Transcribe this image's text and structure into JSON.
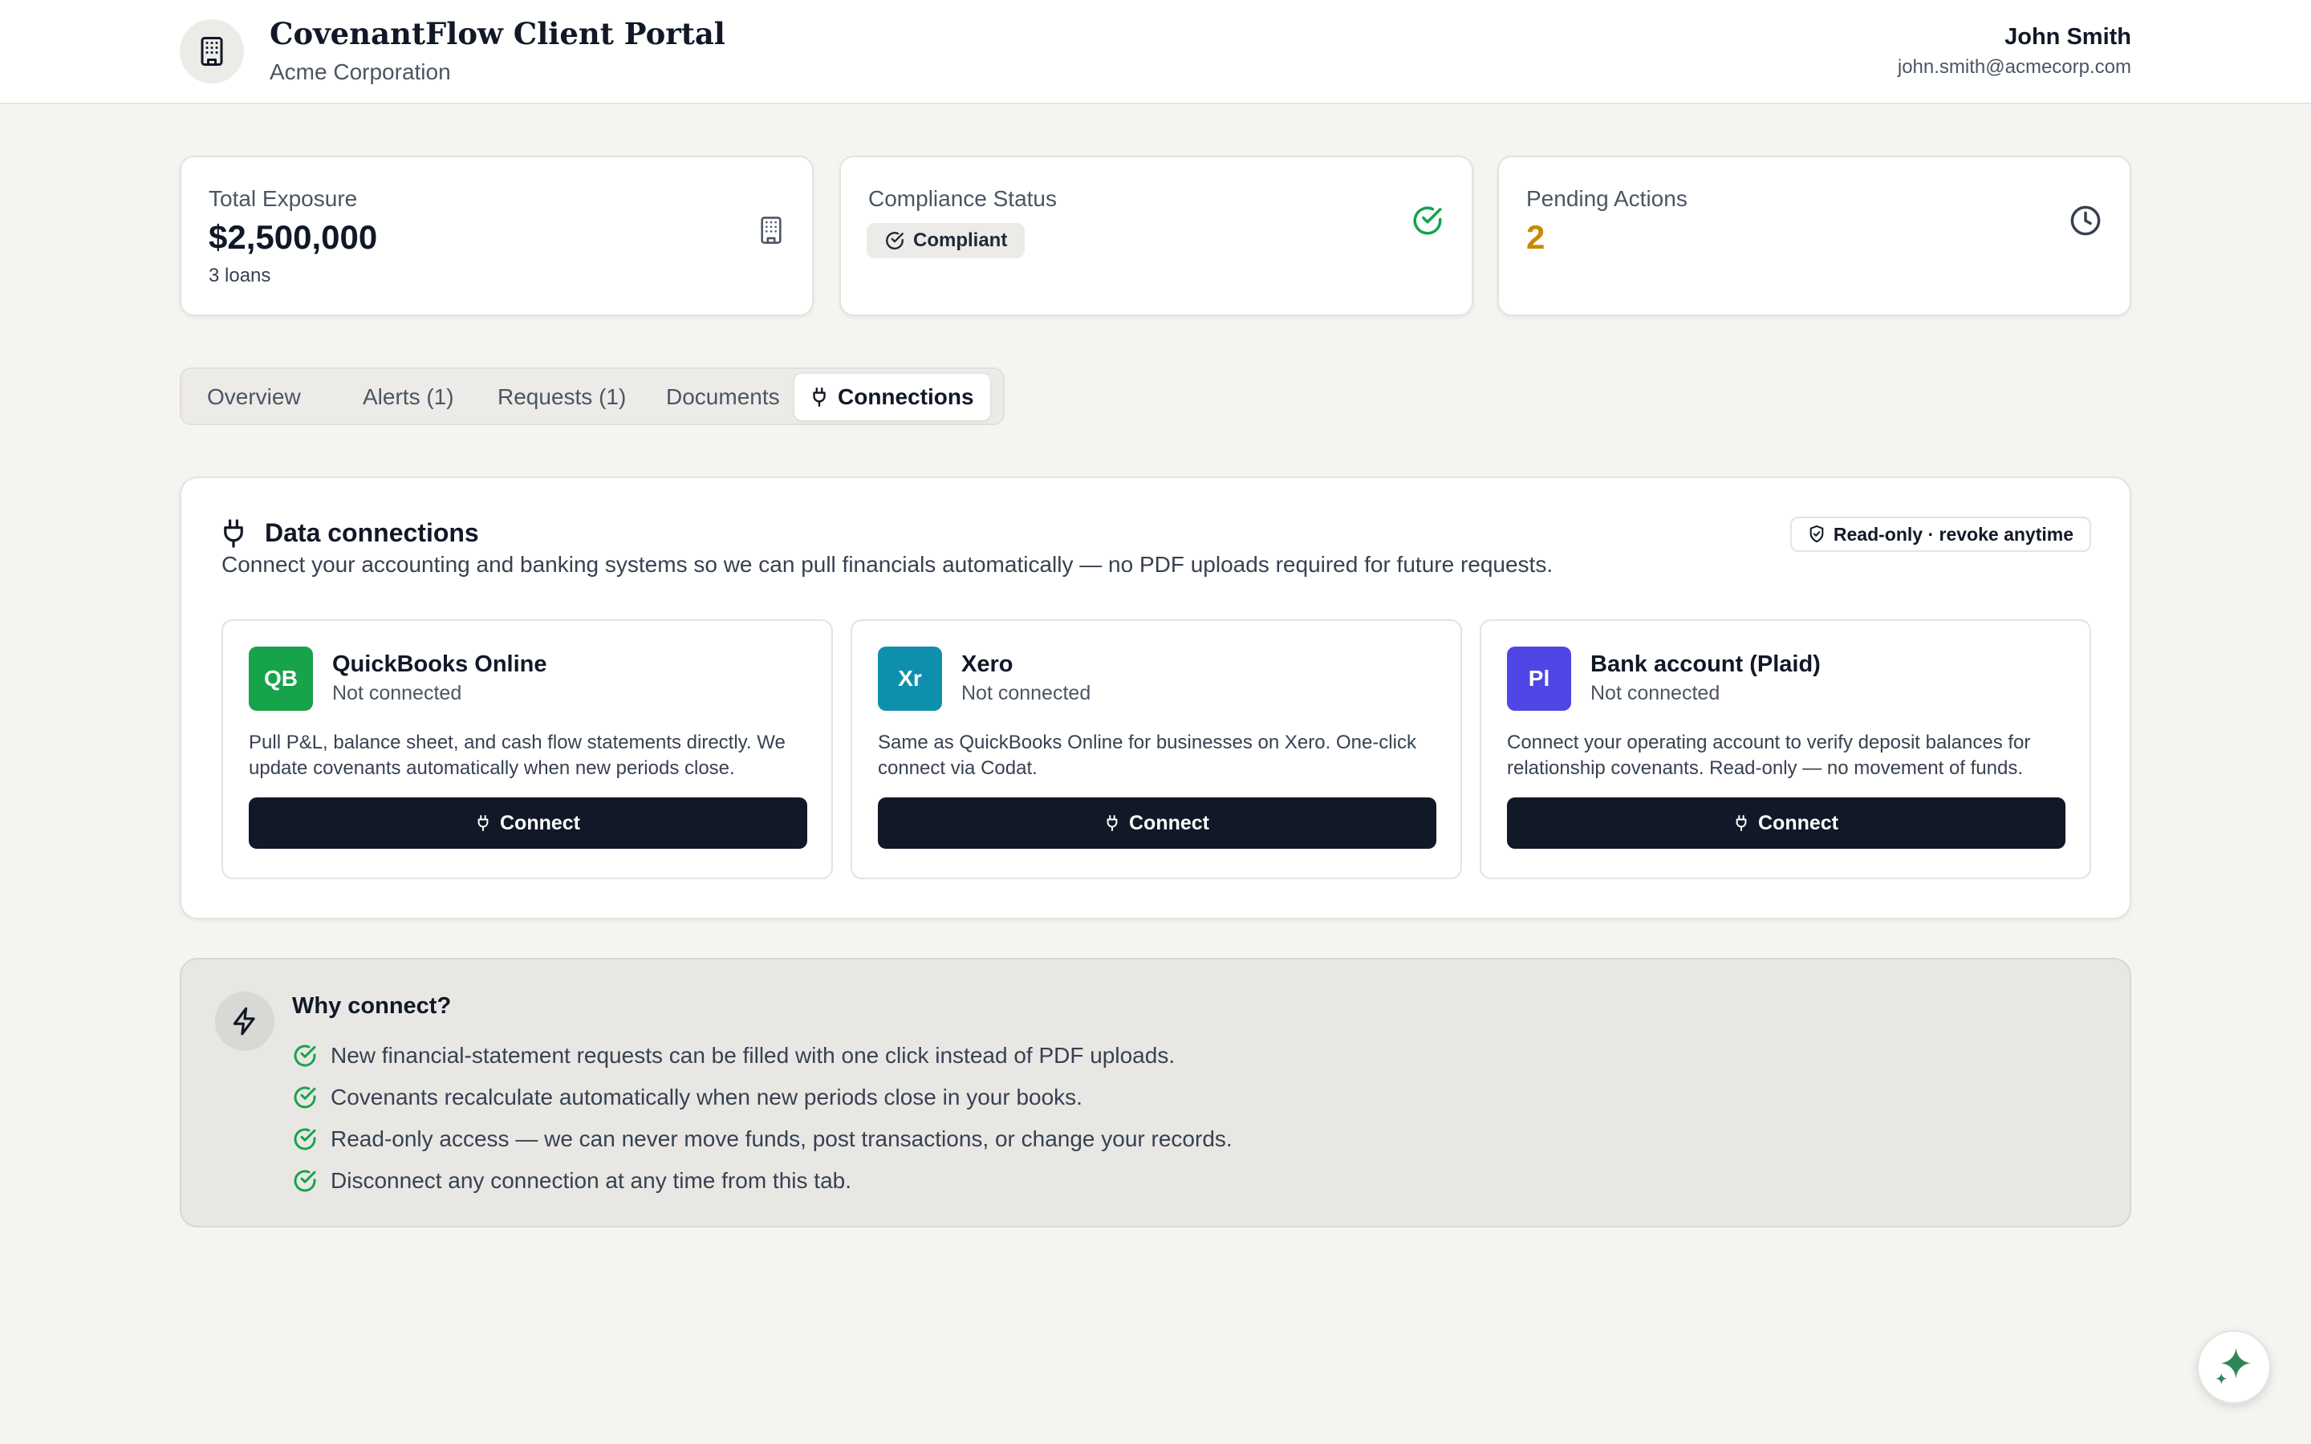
{
  "header": {
    "title": "CovenantFlow Client Portal",
    "company": "Acme Corporation",
    "user_name": "John Smith",
    "user_email": "john.smith@acmecorp.com",
    "brand_icon": "building-icon"
  },
  "stats": {
    "exposure": {
      "label": "Total Exposure",
      "value": "$2,500,000",
      "sub": "3 loans",
      "icon": "building-icon"
    },
    "compliance": {
      "label": "Compliance Status",
      "badge": "Compliant",
      "icon": "check-circle-icon",
      "color": "#16a34a"
    },
    "pending": {
      "label": "Pending Actions",
      "value": "2",
      "icon": "clock-icon",
      "color": "#ca8a04"
    }
  },
  "tabs": [
    {
      "label": "Overview"
    },
    {
      "label": "Alerts (1)"
    },
    {
      "label": "Requests (1)"
    },
    {
      "label": "Documents"
    },
    {
      "label": "Connections",
      "active": true,
      "icon": "plug-icon"
    }
  ],
  "connections": {
    "title": "Data connections",
    "description": "Connect your accounting and banking systems so we can pull financials automatically — no PDF uploads required for future requests.",
    "readonly_badge": "Read-only · revoke anytime",
    "providers": [
      {
        "initials": "QB",
        "name": "QuickBooks Online",
        "status": "Not connected",
        "description": "Pull P&L, balance sheet, and cash flow statements directly. We update covenants automatically when new periods close.",
        "button": "Connect",
        "color": "#16a34a"
      },
      {
        "initials": "Xr",
        "name": "Xero",
        "status": "Not connected",
        "description": "Same as QuickBooks Online for businesses on Xero. One-click connect via Codat.",
        "button": "Connect",
        "color": "#0e8fae"
      },
      {
        "initials": "Pl",
        "name": "Bank account (Plaid)",
        "status": "Not connected",
        "description": "Connect your operating account to verify deposit balances for relationship covenants. Read-only — no movement of funds.",
        "button": "Connect",
        "color": "#4f46e5"
      }
    ]
  },
  "why": {
    "title": "Why connect?",
    "icon": "lightning-icon",
    "items": [
      "New financial-statement requests can be filled with one click instead of PDF uploads.",
      "Covenants recalculate automatically when new periods close in your books.",
      "Read-only access — we can never move funds, post transactions, or change your records.",
      "Disconnect any connection at any time from this tab."
    ]
  },
  "fab": {
    "icon": "sparkle-icon",
    "color": "#2f855a"
  }
}
